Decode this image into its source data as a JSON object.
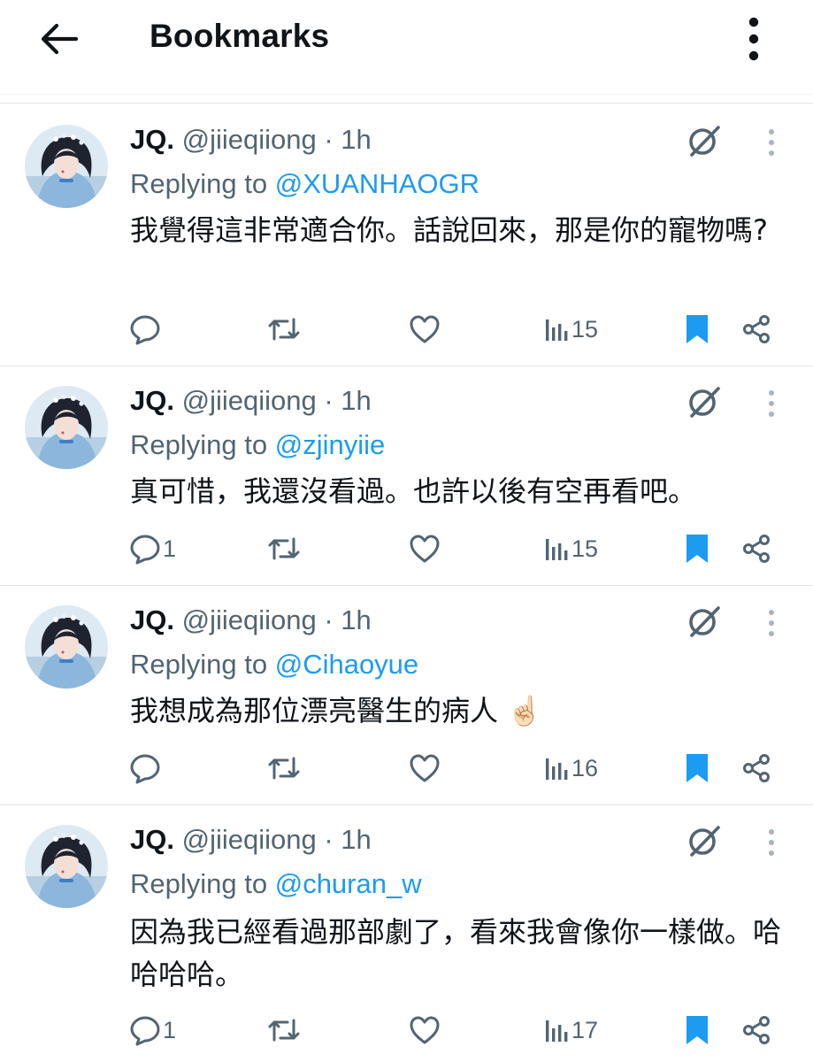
{
  "header": {
    "title": "Bookmarks",
    "back_icon": "arrow-left-icon",
    "menu_icon": "more-vertical-icon"
  },
  "colors": {
    "link": "#1d9bf0",
    "secondary_text": "#536471",
    "primary_text": "#0f1419"
  },
  "tweets": [
    {
      "name": "JQ.",
      "handle": "@jiieqiiong",
      "sep": " · ",
      "time": "1h",
      "replying_prefix": "Replying to ",
      "replying_to": "@XUANHAOGR",
      "text": "我覺得這非常適合你。話說回來，那是你的寵物嗎?",
      "replies": "",
      "views": "15"
    },
    {
      "name": "JQ.",
      "handle": "@jiieqiiong",
      "sep": " · ",
      "time": "1h",
      "replying_prefix": "Replying to ",
      "replying_to": "@zjinyiie",
      "text": "真可惜，我還沒看過。也許以後有空再看吧。",
      "replies": "1",
      "views": "15"
    },
    {
      "name": "JQ.",
      "handle": "@jiieqiiong",
      "sep": " · ",
      "time": "1h",
      "replying_prefix": "Replying to ",
      "replying_to": "@Cihaoyue",
      "text": "我想成為那位漂亮醫生的病人 ☝🏻",
      "replies": "",
      "views": "16"
    },
    {
      "name": "JQ.",
      "handle": "@jiieqiiong",
      "sep": " · ",
      "time": "1h",
      "replying_prefix": "Replying to ",
      "replying_to": "@churan_w",
      "text": "因為我已經看過那部劇了，看來我會像你一樣做。哈哈哈哈。",
      "replies": "1",
      "views": "17"
    }
  ]
}
